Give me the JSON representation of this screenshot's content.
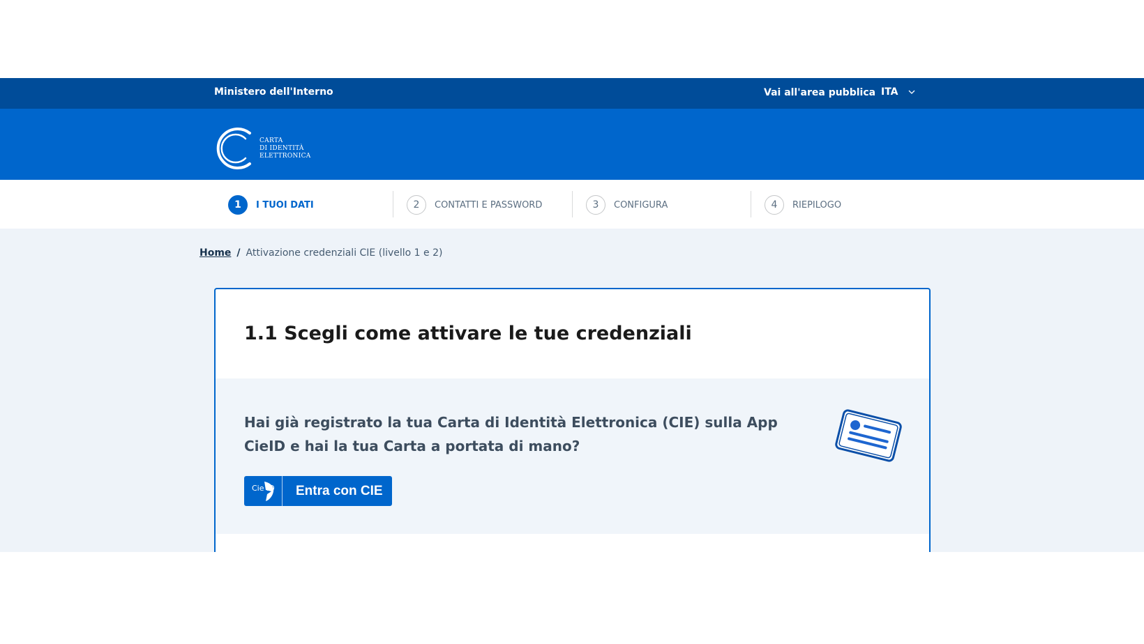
{
  "topbar": {
    "org_name": "Ministero dell'Interno",
    "public_link": "Vai all'area pubblica",
    "language": "ITA"
  },
  "logo": {
    "line1": "CARTA",
    "line2": "DI IDENTITÀ",
    "line3": "ELETTRONICA"
  },
  "stepper": {
    "steps": [
      {
        "number": "1",
        "label": "I TUOI DATI"
      },
      {
        "number": "2",
        "label": "CONTATTI E PASSWORD"
      },
      {
        "number": "3",
        "label": "CONFIGURA"
      },
      {
        "number": "4",
        "label": "RIEPILOGO"
      }
    ],
    "active_step": 1
  },
  "breadcrumb": {
    "home": "Home",
    "separator": "/",
    "current": "Attivazione credenziali CIE (livello 1 e 2)"
  },
  "card": {
    "title": "1.1 Scegli come attivare le tue credenziali",
    "question": "Hai già registrato la tua Carta di Identità Elettronica (CIE) sulla App CieID e hai la tua Carta a portata di mano?",
    "button_label": "Entra con CIE",
    "button_logo_text": "Cie ID"
  },
  "colors": {
    "topbar": "#004c99",
    "brand": "#0066cc",
    "page_bg": "#eef3f9"
  }
}
